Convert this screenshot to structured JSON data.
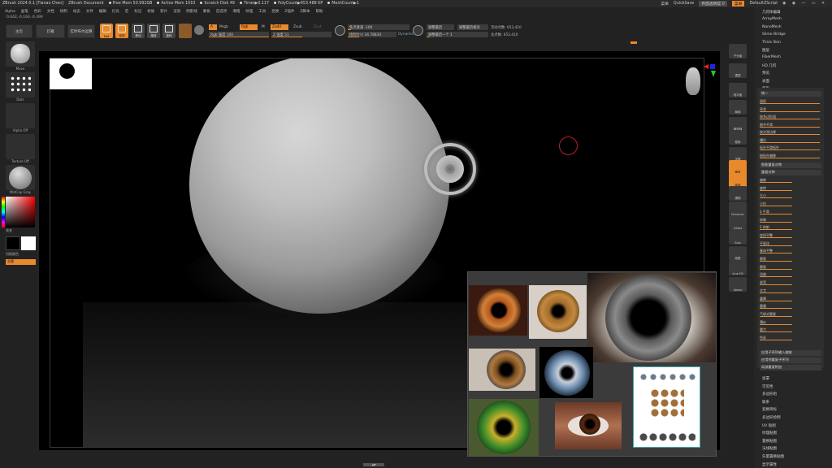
{
  "titlebar": {
    "app": "ZBrush 2024.0.1 [Tianao Chen]",
    "doc": "ZBrush Document",
    "free_mem": "Free Mem 50.992GB",
    "active_mem": "Active Mem 1010",
    "scratch": "Scratch Disk 49",
    "timer": "Timer▶0.117",
    "polycount": "PolyCount▶653.488 KP",
    "meshcount": "MeshCount▶1",
    "menu_label": "菜单",
    "quicksave": "QuickSave",
    "interface_transparency": "界面透明度 0",
    "menus_button": "菜单",
    "default_script": "DefaultZScript"
  },
  "menubar": [
    "Alpha",
    "画笔",
    "色彩",
    "文档",
    "绘制",
    "动态",
    "文件",
    "编辑",
    "灯光",
    "宏",
    "标记",
    "材质",
    "影片",
    "渲染",
    "阴影线",
    "蒙板",
    "首选项",
    "滑稽",
    "纹理",
    "工具",
    "变换",
    "Z插件",
    "Z脚本",
    "帮助"
  ],
  "coords": "0.642,-0.164,-0.396",
  "toolbar": {
    "home": "主页",
    "lightbox": "灯箱",
    "live_boolean": "实时布尔运算",
    "edit": "Edit",
    "draw": "绘制",
    "move": "移动",
    "scale": "缩放",
    "rotate": "旋转",
    "a_label": "A",
    "mrgb": "Mrgb",
    "rgb": "Rgb",
    "m_label": "M",
    "zadd": "Zadd",
    "zsub": "Zsub",
    "zcut": "Zcut",
    "rgb_intensity": "Rgb 强度 100",
    "z_intensity": "Z 强度 51",
    "focal_shift": "焦点衰减 -100",
    "draw_size": "绘制大小 34.78834",
    "dynamic": "Dynamic",
    "adjust_last": "调整最后",
    "adjust_last_value": "调整最后一个 1",
    "adjust_last_relative": "调整最后相对",
    "active_points": "活动点数: 653,410",
    "total_points": "总点数: 653,410"
  },
  "leftpanel": {
    "brush": "Move",
    "stroke": "Dots",
    "alpha": "Alpha Off",
    "texture": "Texture Off",
    "material": "MatCap Gray",
    "gradient": "渐变",
    "switch_color": "切换颜色",
    "alternate": "交替"
  },
  "righticons": [
    "子分级",
    "透视",
    "地平面",
    "局部",
    "缩放轴",
    "框架",
    "平移",
    "缩放",
    "旋转",
    "透明",
    "Dynamic",
    "Ghost",
    "Solo",
    "线框",
    "Line Fill",
    "Xpose"
  ],
  "rightpanel": {
    "top_items": [
      "几何体编辑",
      "ArrayMesh",
      "NanoMesh",
      "Slime Bridge",
      "Thick Skin",
      "图层",
      "FiberMesh",
      "HD 几何",
      "预览",
      "表面",
      "变形"
    ],
    "sub_head_top": "统一",
    "sub_rows": [
      "强权",
      "壳状",
      "按多边形组",
      "细节平滑",
      "按光滑边缘",
      "槽位",
      "拓扑平滑拓扑",
      "按拓扑偏移"
    ],
    "sub_head_2": "智能重复对称",
    "sub_head_3": "重复对称",
    "sub_rows_2": [
      "偏移",
      "旋转",
      "大小",
      "小拉",
      "S 平滑",
      "抑制",
      "S 抑制",
      "绕径平整",
      "平面化",
      "基体平整",
      "膨胀",
      "膨胀",
      "扭曲",
      "渐弯",
      "文字",
      "露障",
      "露露",
      "气球式膨胀",
      "薄纱",
      "重力",
      "色彩"
    ],
    "sub_foot": "应用子序列输入缩放",
    "sub_foot2": "应用到重复子序列",
    "sub_foot3": "局部重复附加",
    "bottom_items": [
      "遮罩",
      "可见性",
      "多边形组",
      "联系",
      "变换目标",
      "多边形绘制",
      "UV 贴图",
      "纹理贴图",
      "置换贴图",
      "法线贴图",
      "矢量置换贴图",
      "显示属性"
    ]
  },
  "colors": {
    "accent": "#e8892c",
    "bg": "#222222",
    "viewport": "#000000"
  }
}
